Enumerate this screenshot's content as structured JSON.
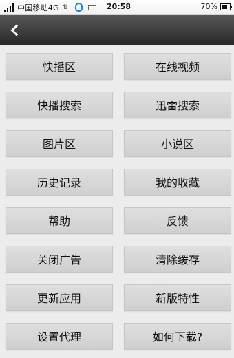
{
  "status_bar": {
    "carrier": "中国移动4G",
    "time": "20:58",
    "battery": "70%"
  },
  "nav": {
    "back_icon": "back-arrow-icon",
    "title": ""
  },
  "menu": {
    "left": [
      "快播区",
      "快播搜索",
      "图片区",
      "历史记录",
      "帮助",
      "关闭广告",
      "更新应用",
      "设置代理"
    ],
    "right": [
      "在线视频",
      "迅雷搜索",
      "小说区",
      "我的收藏",
      "反馈",
      "清除缓存",
      "新版特性",
      "如何下载?"
    ]
  }
}
